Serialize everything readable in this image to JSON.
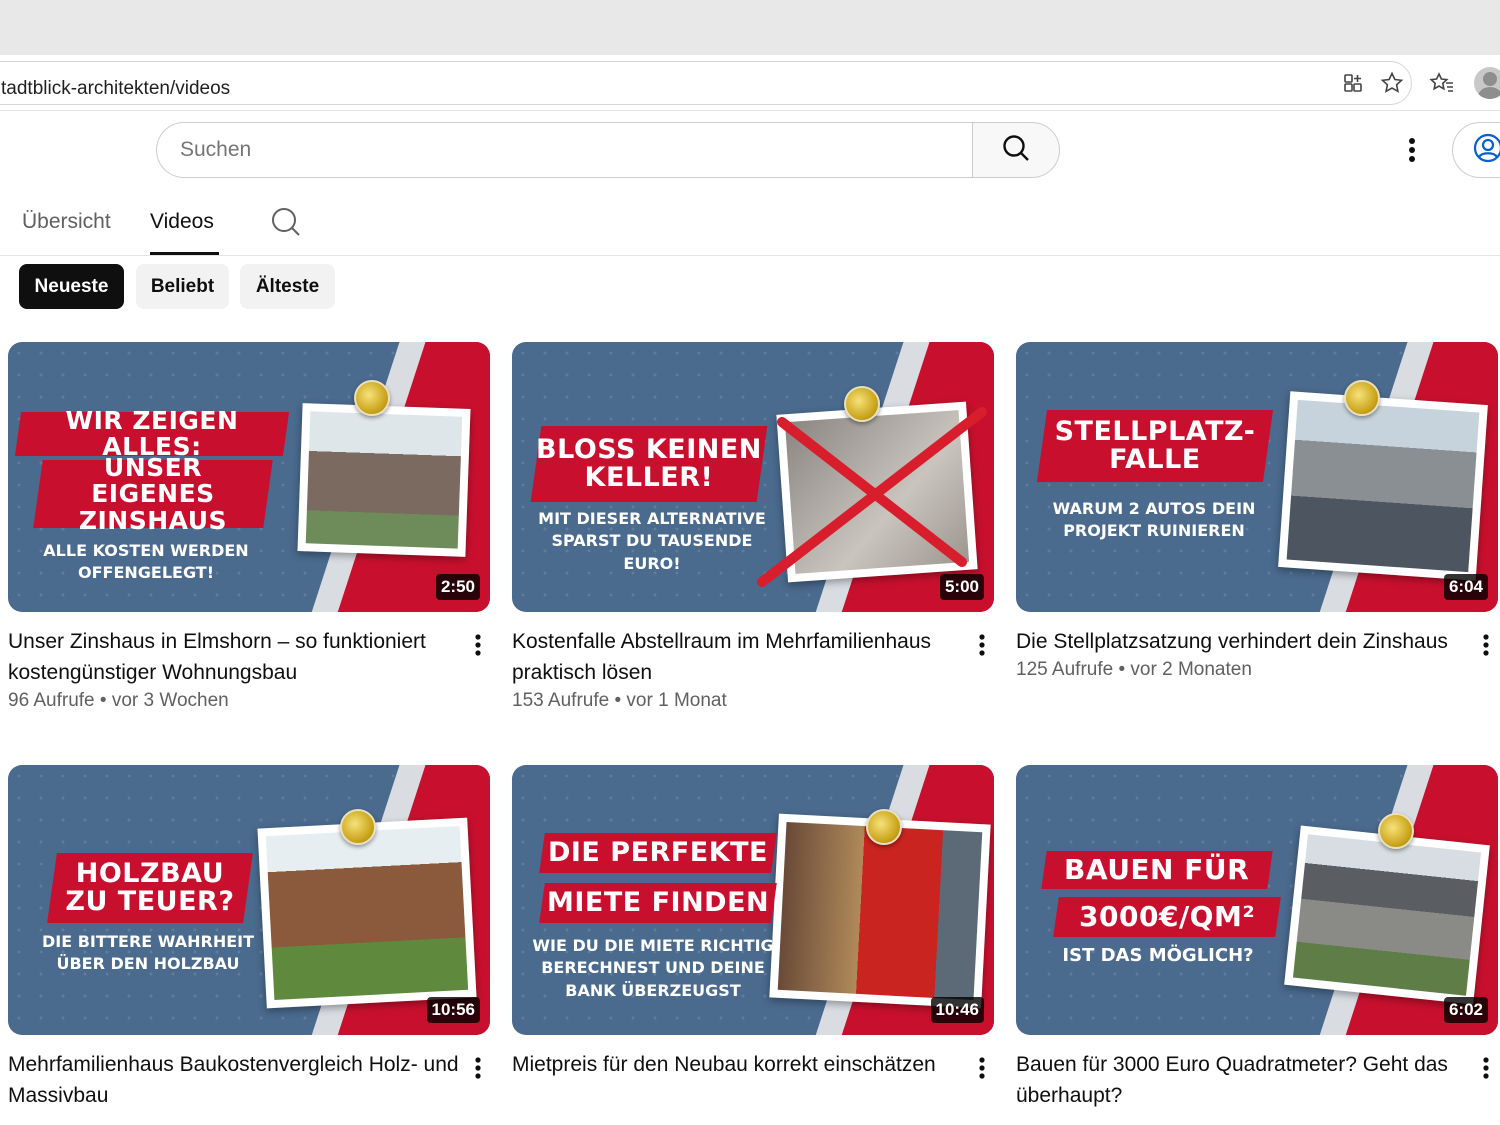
{
  "browser": {
    "url": "tadtblick-architekten/videos"
  },
  "header": {
    "search_placeholder": "Suchen"
  },
  "tabs": [
    {
      "label": "Übersicht"
    },
    {
      "label": "Videos"
    }
  ],
  "chips": [
    {
      "label": "Neueste"
    },
    {
      "label": "Beliebt"
    },
    {
      "label": "Älteste"
    }
  ],
  "videos": [
    {
      "title": "Unser Zinshaus in Elmshorn – so funktioniert kostengünstiger Wohnungsbau",
      "views": "96 Aufrufe",
      "age": "vor 3 Wochen",
      "duration": "2:50",
      "thumb_lines": [
        "WIR ZEIGEN ALLES:",
        "UNSER EIGENES ZINSHAUS"
      ],
      "thumb_sub": "ALLE KOSTEN WERDEN OFFENGELEGT!"
    },
    {
      "title": "Kostenfalle Abstellraum im Mehrfamilienhaus praktisch lösen",
      "views": "153 Aufrufe",
      "age": "vor 1 Monat",
      "duration": "5:00",
      "thumb_lines": [
        "BLOSS KEINEN KELLER!"
      ],
      "thumb_sub": "MIT DIESER ALTERNATIVE SPARST DU TAUSENDE EURO!"
    },
    {
      "title": "Die Stellplatzsatzung verhindert dein Zinshaus",
      "views": "125 Aufrufe",
      "age": "vor 2 Monaten",
      "duration": "6:04",
      "thumb_lines": [
        "STELLPLATZ-FALLE"
      ],
      "thumb_sub": "WARUM 2 AUTOS DEIN PROJEKT RUINIEREN"
    },
    {
      "title": "Mehrfamilienhaus Baukostenvergleich Holz- und Massivbau",
      "duration": "10:56",
      "thumb_lines": [
        "HOLZBAU ZU TEUER?"
      ],
      "thumb_sub": "DIE BITTERE WAHRHEIT ÜBER DEN HOLZBAU"
    },
    {
      "title": "Mietpreis für den Neubau korrekt einschätzen",
      "duration": "10:46",
      "thumb_lines": [
        "DIE PERFEKTE",
        "MIETE FINDEN"
      ],
      "thumb_sub": "WIE DU DIE MIETE RICHTIG BERECHNEST UND DEINE BANK ÜBERZEUGST"
    },
    {
      "title": "Bauen für 3000 Euro Quadratmeter? Geht das überhaupt?",
      "duration": "6:02",
      "thumb_lines": [
        "BAUEN FÜR",
        "3000€/QM²"
      ],
      "thumb_sub": "IST DAS MÖGLICH?"
    }
  ],
  "icons": [
    "apps-icon",
    "star-icon",
    "favorites-icon",
    "profile-avatar",
    "search-icon",
    "more-vert-icon",
    "account-icon",
    "pin-icon"
  ]
}
